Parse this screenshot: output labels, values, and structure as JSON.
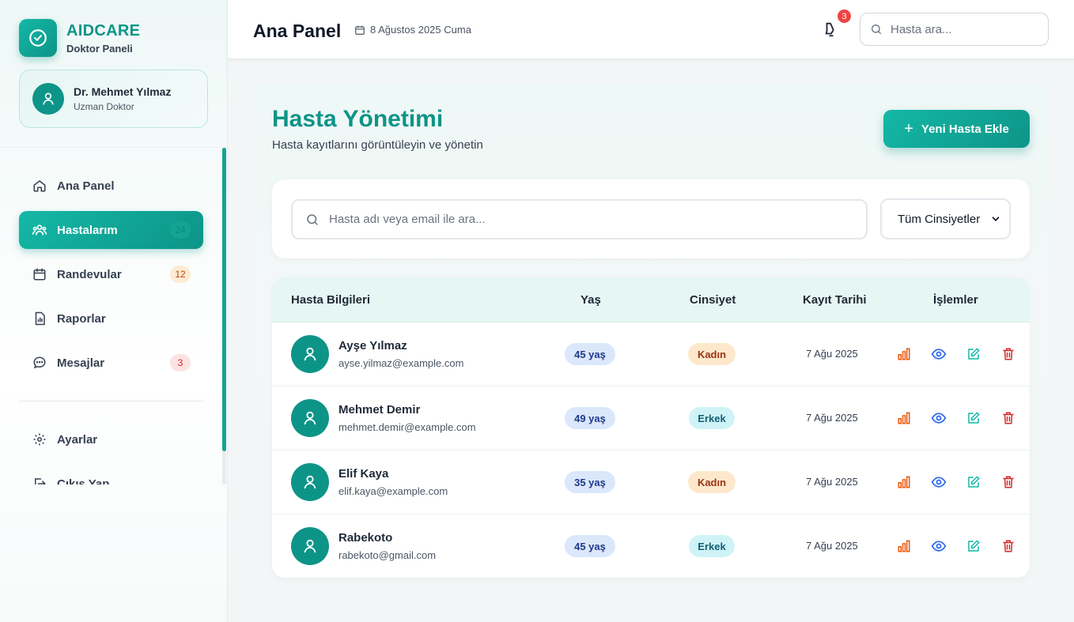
{
  "brand": {
    "name": "AIDCARE",
    "subtitle": "Doktor Paneli"
  },
  "user": {
    "name": "Dr. Mehmet Yılmaz",
    "role": "Uzman Doktor"
  },
  "nav": {
    "items": [
      {
        "label": "Ana Panel",
        "icon": "home-icon"
      },
      {
        "label": "Hastalarım",
        "icon": "users-icon",
        "badge": "24",
        "active": true
      },
      {
        "label": "Randevular",
        "icon": "calendar-icon",
        "badge": "12"
      },
      {
        "label": "Raporlar",
        "icon": "report-icon"
      },
      {
        "label": "Mesajlar",
        "icon": "message-icon",
        "badge": "3"
      }
    ],
    "settings": "Ayarlar",
    "logout": "Çıkış Yap"
  },
  "header": {
    "title": "Ana Panel",
    "date": "8 Ağustos 2025 Cuma",
    "notification_count": "3",
    "search_placeholder": "Hasta ara..."
  },
  "main": {
    "title": "Hasta Yönetimi",
    "subtitle": "Hasta kayıtlarını görüntüleyin ve yönetin",
    "add_button": "Yeni Hasta Ekle",
    "filter_placeholder": "Hasta adı veya email ile ara...",
    "gender_filter": "Tüm Cinsiyetler"
  },
  "table": {
    "headers": [
      "Hasta Bilgileri",
      "Yaş",
      "Cinsiyet",
      "Kayıt Tarihi",
      "İşlemler"
    ],
    "rows": [
      {
        "name": "Ayşe Yılmaz",
        "email": "ayse.yilmaz@example.com",
        "age": "45 yaş",
        "gender": "Kadın",
        "date": "7 Ağu 2025"
      },
      {
        "name": "Mehmet Demir",
        "email": "mehmet.demir@example.com",
        "age": "49 yaş",
        "gender": "Erkek",
        "date": "7 Ağu 2025"
      },
      {
        "name": "Elif Kaya",
        "email": "elif.kaya@example.com",
        "age": "35 yaş",
        "gender": "Kadın",
        "date": "7 Ağu 2025"
      },
      {
        "name": "Rabekoto",
        "email": "rabekoto@gmail.com",
        "age": "45 yaş",
        "gender": "Erkek",
        "date": "7 Ağu 2025"
      }
    ]
  },
  "colors": {
    "primary": "#0d9488",
    "danger": "#dc2626",
    "chart": "#ea580c",
    "view": "#2563eb",
    "edit": "#14b8a6"
  }
}
